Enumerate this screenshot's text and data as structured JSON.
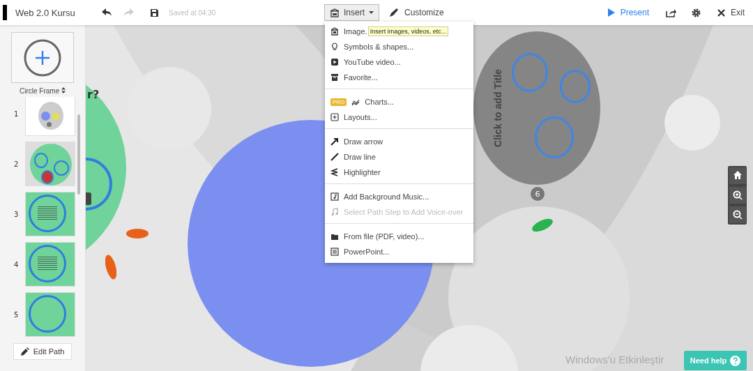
{
  "document": {
    "title": "Web 2.0 Kursu"
  },
  "toolbar": {
    "undo": {
      "disabled": false
    },
    "redo": {
      "disabled": true
    },
    "save_status": "Saved at 04:30",
    "insert": {
      "label": "Insert",
      "expanded": true
    },
    "customize": {
      "label": "Customize"
    },
    "present": {
      "label": "Present"
    },
    "exit": {
      "label": "Exit"
    }
  },
  "insert_menu": {
    "tooltip": "Insert images, videos, etc...",
    "groups": [
      [
        {
          "kind": "image",
          "label": "Image.",
          "disabled": false,
          "pro": false
        },
        {
          "kind": "symbol",
          "label": "Symbols & shapes...",
          "disabled": false,
          "pro": false
        },
        {
          "kind": "youtube",
          "label": "YouTube video...",
          "disabled": false,
          "pro": false
        },
        {
          "kind": "favorite",
          "label": "Favorite...",
          "disabled": false,
          "pro": false
        }
      ],
      [
        {
          "kind": "chart",
          "label": "Charts...",
          "disabled": false,
          "pro": true,
          "badge": "PRO"
        },
        {
          "kind": "layout",
          "label": "Layouts...",
          "disabled": false,
          "pro": false
        }
      ],
      [
        {
          "kind": "arrow",
          "label": "Draw arrow",
          "disabled": false,
          "pro": false
        },
        {
          "kind": "line",
          "label": "Draw line",
          "disabled": false,
          "pro": false
        },
        {
          "kind": "highlighter",
          "label": "Highlighter",
          "disabled": false,
          "pro": false
        }
      ],
      [
        {
          "kind": "music",
          "label": "Add Background Music...",
          "disabled": false,
          "pro": false
        },
        {
          "kind": "voice",
          "label": "Select Path Step to Add Voice-over",
          "disabled": true,
          "pro": false
        }
      ],
      [
        {
          "kind": "file",
          "label": "From file (PDF, video)...",
          "disabled": false,
          "pro": false
        },
        {
          "kind": "powerpoint",
          "label": "PowerPoint...",
          "disabled": false,
          "pro": false
        }
      ]
    ]
  },
  "sidebar": {
    "frame_picker": {
      "label": "Circle Frame"
    },
    "steps": [
      {
        "number": "1",
        "kind": "overview"
      },
      {
        "number": "2",
        "kind": "scene"
      },
      {
        "number": "3",
        "kind": "text"
      },
      {
        "number": "4",
        "kind": "text"
      },
      {
        "number": "5",
        "kind": "empty"
      }
    ],
    "edit_path": "Edit Path"
  },
  "canvas": {
    "partial_title": "r?",
    "frame_title": "Click to add Title",
    "step_badge": "6"
  },
  "os_notice": "Windows'u Etkinleştir",
  "help_button": "Need help"
}
